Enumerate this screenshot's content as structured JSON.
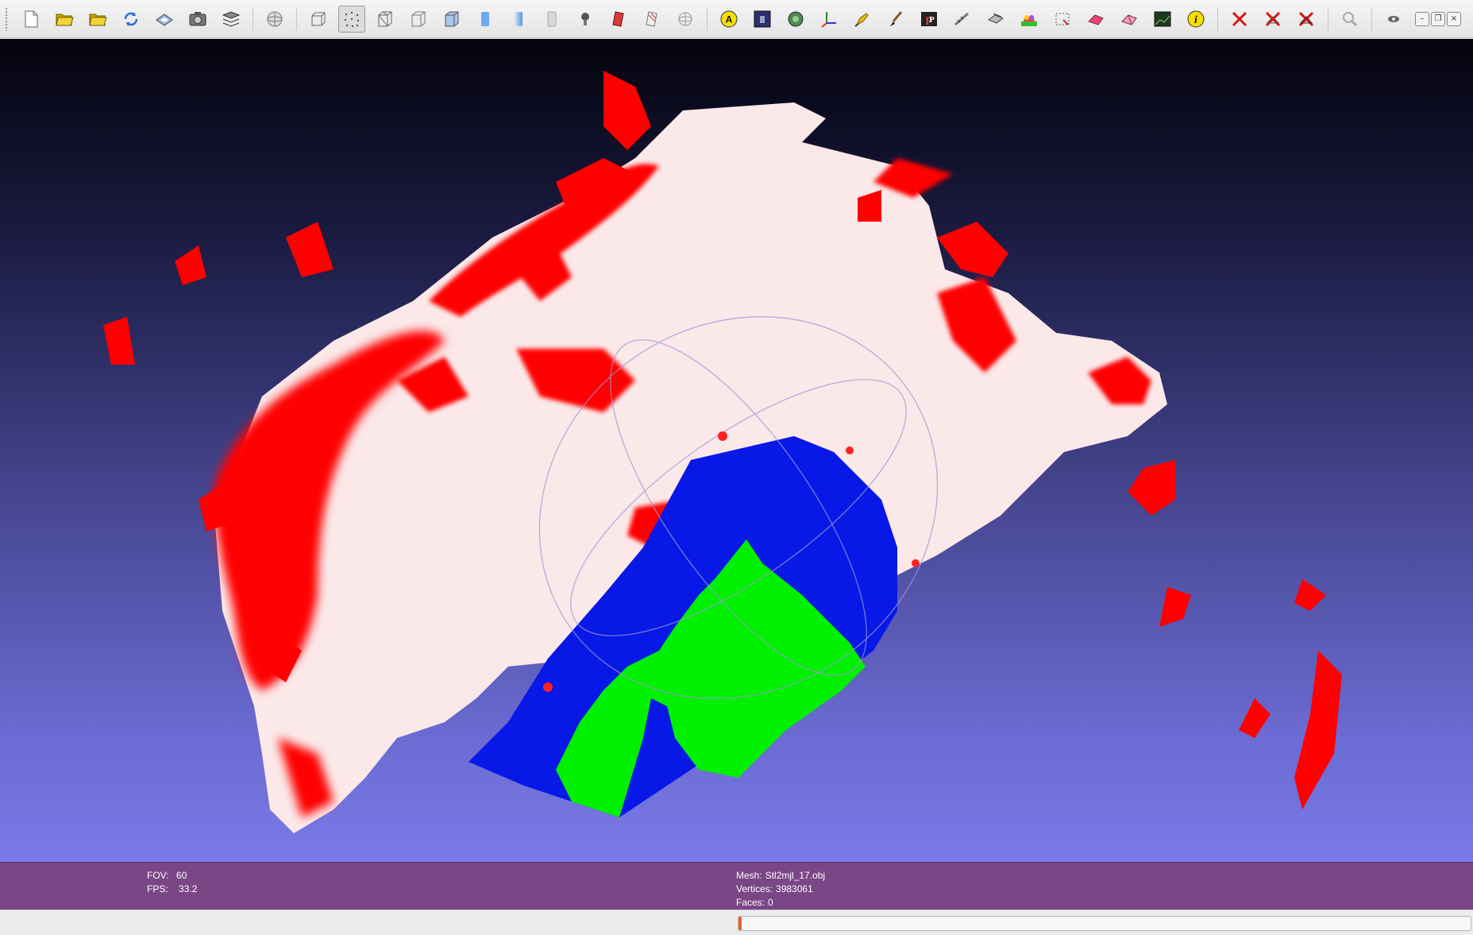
{
  "toolbar": {
    "buttons": [
      {
        "name": "new-project",
        "icon": "new-document-icon"
      },
      {
        "name": "open-project",
        "icon": "open-folder-icon"
      },
      {
        "name": "import-mesh",
        "icon": "import-folder-icon"
      },
      {
        "name": "reload",
        "icon": "reload-icon"
      },
      {
        "name": "save",
        "icon": "save-icon"
      },
      {
        "name": "snapshot",
        "icon": "camera-icon"
      },
      {
        "name": "layers",
        "icon": "layers-icon"
      },
      {
        "name": "trackball",
        "icon": "trackball-icon"
      },
      {
        "name": "bbox",
        "icon": "bbox-icon"
      },
      {
        "name": "points",
        "icon": "points-icon"
      },
      {
        "name": "wireframe",
        "icon": "wireframe-icon"
      },
      {
        "name": "hidden-lines",
        "icon": "hidden-lines-icon"
      },
      {
        "name": "flat-lines",
        "icon": "flat-lines-icon"
      },
      {
        "name": "flat",
        "icon": "flat-icon"
      },
      {
        "name": "smooth",
        "icon": "smooth-icon"
      },
      {
        "name": "texture",
        "icon": "texture-icon"
      },
      {
        "name": "lighting",
        "icon": "light-bulb-icon"
      },
      {
        "name": "fancy-lighting",
        "icon": "fancy-light-icon"
      },
      {
        "name": "double-lighting",
        "icon": "double-light-icon"
      },
      {
        "name": "backface-culling",
        "icon": "sphere-icon"
      },
      {
        "name": "annotation",
        "icon": "annotation-icon"
      },
      {
        "name": "shader",
        "icon": "shader-icon"
      },
      {
        "name": "render-mode",
        "icon": "render-mode-icon"
      },
      {
        "name": "axis",
        "icon": "axis-icon"
      },
      {
        "name": "paint",
        "icon": "paint-icon"
      },
      {
        "name": "brush",
        "icon": "brush-icon"
      },
      {
        "name": "pick-points",
        "icon": "pick-points-icon"
      },
      {
        "name": "measure",
        "icon": "measure-icon"
      },
      {
        "name": "align",
        "icon": "align-icon"
      },
      {
        "name": "color",
        "icon": "color-icon"
      },
      {
        "name": "select-faces",
        "icon": "select-faces-icon"
      },
      {
        "name": "select-vertices",
        "icon": "select-vertices-icon"
      },
      {
        "name": "select-connected",
        "icon": "select-connected-icon"
      },
      {
        "name": "raster",
        "icon": "raster-icon"
      },
      {
        "name": "info",
        "icon": "info-icon"
      },
      {
        "name": "delete-faces",
        "icon": "delete-faces-icon"
      },
      {
        "name": "delete-vertices",
        "icon": "delete-vertices-icon"
      },
      {
        "name": "delete-all",
        "icon": "delete-all-icon"
      },
      {
        "name": "search",
        "icon": "search-icon"
      }
    ]
  },
  "info": {
    "fov_label": "FOV:",
    "fov_value": "60",
    "fps_label": "FPS:",
    "fps_value": "33.2",
    "mesh_label": "Mesh:",
    "mesh_value": "Stl2mjl_17.obj",
    "vertices_label": "Vertices:",
    "vertices_value": "3983061",
    "faces_label": "Faces:",
    "faces_value": "0"
  },
  "status": {
    "progress": 0.004
  },
  "colors": {
    "info_bar": "#7a4686",
    "background_top": "#03030d",
    "background_bottom": "#7a7ae8",
    "points_red": "#ff0000",
    "points_white": "#fbe6e6",
    "points_blue": "#0a1ae6",
    "points_green": "#00f000",
    "progress_fill": "#e6622a"
  }
}
